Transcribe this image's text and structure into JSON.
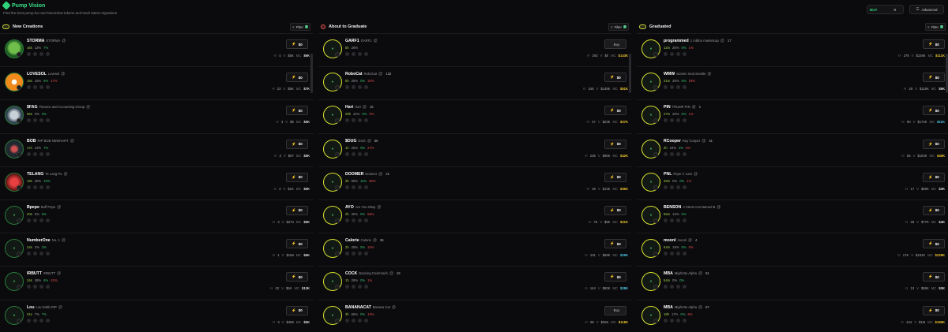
{
  "header": {
    "title": "Pump Vision",
    "subtitle": "Find the best pump.fun and Moonshot tokens and track latest migrations",
    "buy_label": "BUY",
    "buy_value": "0",
    "advanced_label": "Advanced"
  },
  "columns": [
    {
      "title": "New Creations",
      "filter_label": "Filter",
      "filter_count": "2",
      "cards": [
        {
          "ticker": "STORMA",
          "name": "STORMA",
          "holders": "",
          "age": "16s",
          "p1": "13%",
          "p2": "7%",
          "p3": "",
          "buy": "$0",
          "m1": "4",
          "m2": "$5K",
          "m3": "$6K",
          "mc": "white",
          "avatar": "img1"
        },
        {
          "ticker": "LOVESOL",
          "name": "Lovesol",
          "holders": "",
          "age": "16s",
          "p1": "15%",
          "p2": "6%",
          "p3": "17%",
          "buy": "$0",
          "m1": "22",
          "m2": "$5K",
          "m3": "$7K",
          "mc": "white",
          "avatar": "img2"
        },
        {
          "ticker": "$FAG",
          "name": "Finance and Accounting Group",
          "holders": "",
          "age": "66s",
          "p1": "0%",
          "p2": "0%",
          "p3": "",
          "buy": "$0",
          "m1": "3",
          "m2": "$5",
          "m3": "$5K",
          "mc": "white",
          "avatar": "img3"
        },
        {
          "ticker": "BOB",
          "name": "RIP BOB NEWHART",
          "holders": "",
          "age": "17s",
          "p1": "13%",
          "p2": "7%",
          "p3": "",
          "buy": "$0",
          "m1": "2",
          "m2": "$97",
          "m3": "$5K",
          "mc": "white",
          "avatar": "img4"
        },
        {
          "ticker": "TELANG",
          "name": "Te Lang Pu",
          "holders": "",
          "age": "19s",
          "p1": "30%",
          "p2": "16%",
          "p3": "",
          "buy": "$0",
          "m1": "2",
          "m2": "$1K",
          "m3": "$6K",
          "mc": "white",
          "avatar": "img5"
        },
        {
          "ticker": "Bpepe",
          "name": "Buff Pepe",
          "holders": "",
          "age": "20s",
          "p1": "5%",
          "p2": "5%",
          "p3": "",
          "buy": "$0",
          "m1": "3",
          "m2": "$374",
          "m3": "$6K",
          "mc": "white",
          "avatar": ""
        },
        {
          "ticker": "NumberOne",
          "name": "No. 1",
          "holders": "",
          "age": "24s",
          "p1": "2%",
          "p2": "2%",
          "p3": "",
          "buy": "$0",
          "m1": "1",
          "m2": "$158",
          "m3": "$6K",
          "mc": "white",
          "avatar": ""
        },
        {
          "ticker": "IRBUTT",
          "name": "IRBUTT",
          "holders": "",
          "age": "24s",
          "p1": "38%",
          "p2": "6%",
          "p3": "42%",
          "buy": "$0",
          "m1": "22",
          "m2": "$5K",
          "m3": "$13K",
          "mc": "white",
          "avatar": ""
        },
        {
          "ticker": "Lou",
          "name": "Lou Dobb RIP",
          "holders": "",
          "age": "31s",
          "p1": "7%",
          "p2": "7%",
          "p3": "",
          "buy": "$0",
          "m1": "3",
          "m2": "$488",
          "m3": "$5K",
          "mc": "white",
          "avatar": ""
        }
      ]
    },
    {
      "title": "About to Graduate",
      "filter_label": "Filter",
      "filter_count": "2",
      "cards": [
        {
          "ticker": "GARF1",
          "name": "GARF1",
          "holders": "",
          "age": "5h",
          "p1": "26%",
          "p2": "",
          "p3": "",
          "buy": "Buy",
          "m1": "292",
          "m2": "$0",
          "m3": "$143K",
          "mc": "yellow",
          "avatar": ""
        },
        {
          "ticker": "RoboCat",
          "name": "RoboCat",
          "holders": "132",
          "age": "5h",
          "p1": "26%",
          "p2": "0%",
          "p3": "10%",
          "buy": "$0",
          "m1": "348",
          "m2": "$148K",
          "m3": "$51K",
          "mc": "yellow",
          "avatar": ""
        },
        {
          "ticker": "Hari",
          "name": "Hari",
          "holders": "16",
          "age": "29h",
          "p1": "41%",
          "p2": "0%",
          "p3": "0%",
          "buy": "$0",
          "m1": "47",
          "m2": "$23K",
          "m3": "$37K",
          "mc": "yellow",
          "avatar": ""
        },
        {
          "ticker": "$DUG",
          "name": "DUG",
          "holders": "66",
          "age": "1h",
          "p1": "25%",
          "p2": "0%",
          "p3": "27%",
          "buy": "$0",
          "m1": "235",
          "m2": "$96K",
          "m3": "$42K",
          "mc": "yellow",
          "avatar": ""
        },
        {
          "ticker": "DOOMER",
          "name": "Doomer",
          "holders": "21",
          "age": "3h",
          "p1": "65%",
          "p2": "11%",
          "p3": "66%",
          "buy": "$0",
          "m1": "19",
          "m2": "$13K",
          "m3": "$36K",
          "mc": "yellow",
          "avatar": ""
        },
        {
          "ticker": "AYO",
          "name": "Are You Okay",
          "holders": "",
          "age": "2h",
          "p1": "30%",
          "p2": "0%",
          "p3": "56%",
          "buy": "$0",
          "m1": "75",
          "m2": "$8K",
          "m3": "$31K",
          "mc": "yellow",
          "avatar": ""
        },
        {
          "ticker": "Calorie",
          "name": "Calorie",
          "holders": "35",
          "age": "2h",
          "p1": "28%",
          "p2": "0%",
          "p3": "10%",
          "buy": "$0",
          "m1": "101",
          "m2": "$58K",
          "m3": "$29K",
          "mc": "cyan",
          "avatar": ""
        },
        {
          "ticker": "COCK",
          "name": "Dancing Cockroach",
          "holders": "19",
          "age": "1h",
          "p1": "28%",
          "p2": "0%",
          "p3": "1%",
          "buy": "$0",
          "m1": "144",
          "m2": "$80K",
          "m3": "$28K",
          "mc": "cyan",
          "avatar": ""
        },
        {
          "ticker": "BANANACAT",
          "name": "Banana Cat",
          "holders": "",
          "age": "3h",
          "p1": "66%",
          "p2": "0%",
          "p3": "13%",
          "buy": "Buy",
          "m1": "96",
          "m2": "$36K",
          "m3": "$118K",
          "mc": "yellow",
          "avatar": ""
        }
      ]
    },
    {
      "title": "Graduated",
      "filter_label": "Filter",
      "filter_count": "2",
      "cards": [
        {
          "ticker": "programmed",
          "name": "1 million marketcap",
          "holders": "17",
          "age": "12m",
          "p1": "26%",
          "p2": "0%",
          "p3": "1%",
          "buy": "$0",
          "m1": "278",
          "m2": "$226K",
          "m3": "$111K",
          "mc": "yellow",
          "avatar": ""
        },
        {
          "ticker": "WMW",
          "name": "women mod wrestle",
          "holders": "",
          "age": "21m",
          "p1": "26%",
          "p2": "5%",
          "p3": "19%",
          "buy": "$0",
          "m1": "29",
          "m2": "$116K",
          "m3": "$5K",
          "mc": "white",
          "avatar": ""
        },
        {
          "ticker": "PIN",
          "name": "TRUMP PIN",
          "holders": "1",
          "age": "27m",
          "p1": "26%",
          "p2": "0%",
          "p3": "1%",
          "buy": "$0",
          "m1": "90",
          "m2": "$174K",
          "m3": "$21K",
          "mc": "cyan",
          "avatar": ""
        },
        {
          "ticker": "RCooper",
          "name": "Ray Cooper",
          "holders": "41",
          "age": "2h",
          "p1": "34%",
          "p2": "2%",
          "p3": "5%",
          "buy": "$0",
          "m1": "56",
          "m2": "$104K",
          "m3": "$46K",
          "mc": "yellow",
          "avatar": ""
        },
        {
          "ticker": "PNL",
          "name": "Pepe n' Lora",
          "holders": "",
          "age": "48m",
          "p1": "0%",
          "p2": "0%",
          "p3": "1%",
          "buy": "$0",
          "m1": "17",
          "m2": "$59K",
          "m3": "$3K",
          "mc": "white",
          "avatar": ""
        },
        {
          "ticker": "BENSON",
          "name": "A Street Cat Named B",
          "holders": "",
          "age": "55m",
          "p1": "13%",
          "p2": "0%",
          "p3": "",
          "buy": "$0",
          "m1": "28",
          "m2": "$77K",
          "m3": "$4K",
          "mc": "white",
          "avatar": ""
        },
        {
          "ticker": "moonl",
          "name": "moonl",
          "holders": "4",
          "age": "54m",
          "p1": "18%",
          "p2": "0%",
          "p3": "0%",
          "buy": "$0",
          "m1": "17K",
          "m2": "$181K",
          "m3": "$228K",
          "mc": "yellow",
          "avatar": ""
        },
        {
          "ticker": "MBA",
          "name": "Might Be Alpha",
          "holders": "61",
          "age": "54m",
          "p1": "0%",
          "p2": "0%",
          "p3": "",
          "buy": "$0",
          "m1": "13",
          "m2": "$55K",
          "m3": "$3K",
          "mc": "white",
          "avatar": ""
        },
        {
          "ticker": "MBA",
          "name": "Might Be Alpha",
          "holders": "67",
          "age": "18h",
          "p1": "17%",
          "p2": "0%",
          "p3": "6%",
          "buy": "$0",
          "m1": "444",
          "m2": "$1M",
          "m3": "$199K",
          "mc": "yellow",
          "avatar": ""
        }
      ]
    }
  ]
}
